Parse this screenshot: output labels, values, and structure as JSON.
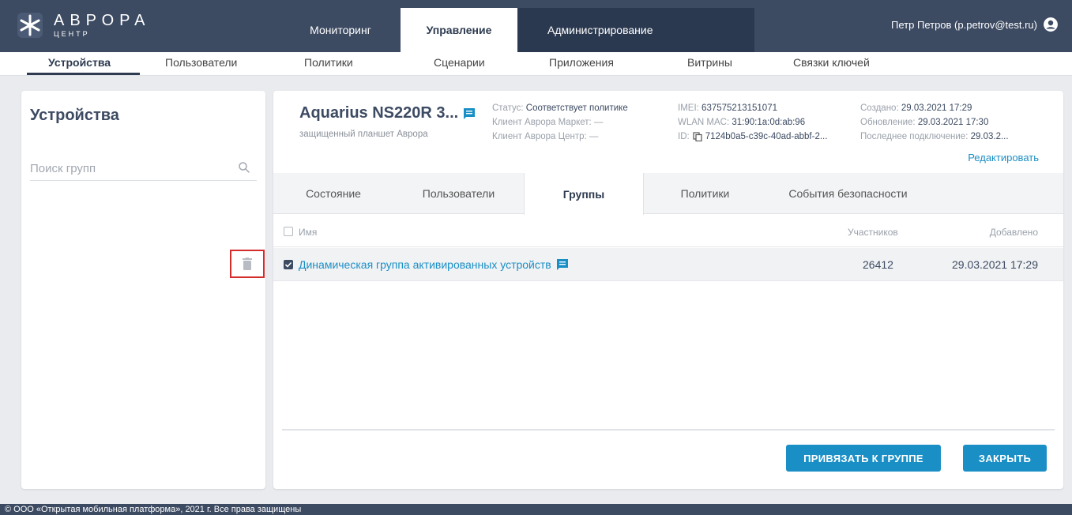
{
  "header": {
    "logo_title": "АВРОРА",
    "logo_sub": "ЦЕНТР",
    "tabs": [
      {
        "label": "Мониторинг"
      },
      {
        "label": "Управление"
      },
      {
        "label": "Администрирование"
      }
    ],
    "user": "Петр Петров (p.petrov@test.ru)"
  },
  "subnav": {
    "items": [
      {
        "label": "Устройства"
      },
      {
        "label": "Пользователи"
      },
      {
        "label": "Политики"
      },
      {
        "label": "Сценарии"
      },
      {
        "label": "Приложения"
      },
      {
        "label": "Витрины"
      },
      {
        "label": "Связки ключей"
      }
    ]
  },
  "left": {
    "title": "Устройства",
    "search_placeholder": "Поиск групп"
  },
  "device": {
    "name": "Aquarius NS220R 3...",
    "subtitle": "защищенный планшет Аврора",
    "status_label": "Статус:",
    "status_value": "Соответствует политике",
    "market_label": "Клиент Аврора Маркет:",
    "market_value": "—",
    "center_label": "Клиент Аврора Центр:",
    "center_value": "—",
    "imei_label": "IMEI:",
    "imei_value": "637575213151071",
    "mac_label": "WLAN MAC:",
    "mac_value": "31:90:1a:0d:ab:96",
    "id_label": "ID:",
    "id_value": "7124b0a5-c39c-40ad-abbf-2...",
    "created_label": "Создано:",
    "created_value": "29.03.2021 17:29",
    "updated_label": "Обновление:",
    "updated_value": "29.03.2021 17:30",
    "last_label": "Последнее подключение:",
    "last_value": "29.03.2...",
    "edit_link": "Редактировать"
  },
  "tabs": [
    {
      "label": "Состояние"
    },
    {
      "label": "Пользователи"
    },
    {
      "label": "Группы"
    },
    {
      "label": "Политики"
    },
    {
      "label": "События безопасности"
    }
  ],
  "table": {
    "columns": {
      "name": "Имя",
      "members": "Участников",
      "added": "Добавлено"
    },
    "rows": [
      {
        "name": "Динамическая группа активированных устройств",
        "members": "26412",
        "added": "29.03.2021 17:29"
      }
    ]
  },
  "buttons": {
    "bind": "ПРИВЯЗАТЬ К ГРУППЕ",
    "close": "ЗАКРЫТЬ"
  },
  "footer": "© ООО «Открытая мобильная платформа», 2021 г. Все права защищены",
  "colors": {
    "header_bg": "#3c4a62",
    "accent": "#1a8fc6",
    "highlight": "#d42b2b"
  }
}
